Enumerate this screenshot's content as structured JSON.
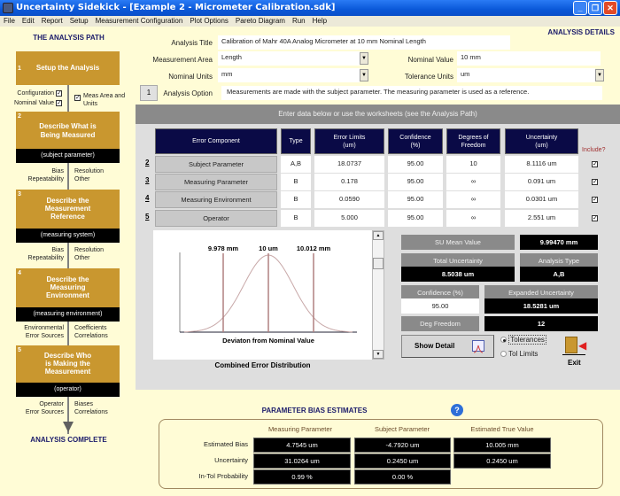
{
  "window": {
    "title": "Uncertainty Sidekick - [Example 2 - Micrometer Calibration.sdk]",
    "controls": {
      "minimize": "_",
      "maximize": "❐",
      "close": "✕"
    }
  },
  "menu": [
    "File",
    "Edit",
    "Report",
    "Setup",
    "Measurement Configuration",
    "Plot Options",
    "Pareto Diagram",
    "Run",
    "Help"
  ],
  "path": {
    "title": "THE ANALYSIS PATH",
    "steps": [
      {
        "num": "1",
        "title": "Setup the Analysis",
        "sub": ""
      },
      {
        "num": "2",
        "title": "Describe What is Being Measured",
        "sub": "(subject parameter)"
      },
      {
        "num": "3",
        "title": "Describe the Measurement Reference",
        "sub": "(measuring system)"
      },
      {
        "num": "4",
        "title": "Describe the Measuring Environment",
        "sub": "(measuring environment)"
      },
      {
        "num": "5",
        "title": "Describe Who is Making the Measurement",
        "sub": "(operator)"
      }
    ],
    "setup_checks": {
      "configuration": "Configuration",
      "nominal_value": "Nominal Value",
      "meas_area": "Meas Area and Units"
    },
    "step2_left": [
      "Bias",
      "Repeatability"
    ],
    "step2_right": [
      "Resolution",
      "Other"
    ],
    "step3_left": [
      "Bias",
      "Repeatability"
    ],
    "step3_right": [
      "Resolution",
      "Other"
    ],
    "step4_left": [
      "Environmental",
      "Error Sources"
    ],
    "step4_right": [
      "Coefficients",
      "Correlations"
    ],
    "step5_left": [
      "Operator",
      "Error Sources"
    ],
    "step5_right": [
      "Biases",
      "Correlations"
    ],
    "complete": "ANALYSIS COMPLETE"
  },
  "details": {
    "title": "ANALYSIS DETAILS",
    "analysis_title_label": "Analysis Title",
    "analysis_title": "Calibration of Mahr 40A Analog Micrometer at 10 mm Nominal Length",
    "measurement_area_label": "Measurement Area",
    "measurement_area": "Length",
    "nominal_value_label": "Nominal Value",
    "nominal_value": "10 mm",
    "nominal_units_label": "Nominal Units",
    "nominal_units": "mm",
    "tolerance_units_label": "Tolerance Units",
    "tolerance_units": "um",
    "option_button": "1",
    "analysis_option_label": "Analysis Option",
    "analysis_option": "Measurements are made with the subject parameter.  The measuring parameter is used as a reference."
  },
  "table": {
    "banner": "Enter data below or use the worksheets (see the Analysis Path)",
    "headers": [
      "Error Component",
      "Type",
      "Error Limits (um)",
      "Confidence (%)",
      "Degrees of Freedom",
      "Uncertainty (um)"
    ],
    "include_label": "Include?",
    "rows": [
      {
        "num": "2",
        "component": "Subject Parameter",
        "type": "A,B",
        "limits": "18.0737",
        "confidence": "95.00",
        "dof": "10",
        "uncertainty": "8.1116 um",
        "include": true
      },
      {
        "num": "3",
        "component": "Measuring Parameter",
        "type": "B",
        "limits": "0.178",
        "confidence": "95.00",
        "dof": "∞",
        "uncertainty": "0.091 um",
        "include": true
      },
      {
        "num": "4",
        "component": "Measuring Environment",
        "type": "B",
        "limits": "0.0590",
        "confidence": "95.00",
        "dof": "∞",
        "uncertainty": "0.0301 um",
        "include": true
      },
      {
        "num": "5",
        "component": "Operator",
        "type": "B",
        "limits": "5.000",
        "confidence": "95.00",
        "dof": "∞",
        "uncertainty": "2.551 um",
        "include": true
      }
    ]
  },
  "chart": {
    "caption": "Combined Error Distribution",
    "xlabel": "Deviaton from Nominal Value",
    "markers": [
      {
        "label": "9.978 mm",
        "position": -1
      },
      {
        "label": "10 um",
        "position": 0
      },
      {
        "label": "10.012 mm",
        "position": 1
      }
    ],
    "curve_color": "#c8a8a8",
    "marker_color": "#b08080"
  },
  "results": {
    "su_mean_label": "SU Mean Value",
    "su_mean": "9.99470 mm",
    "total_unc_label": "Total Uncertainty",
    "total_unc": "8.5038 um",
    "analysis_type_label": "Analysis Type",
    "analysis_type": "A,B",
    "confidence_label": "Confidence (%)",
    "confidence": "95.00",
    "expanded_label": "Expanded Uncertainty",
    "expanded": "18.5281 um",
    "dof_label": "Deg Freedom",
    "dof": "12",
    "show_detail": "Show Detail",
    "radio_tolerances": "Tolerances",
    "radio_tol_limits": "Tol Limits",
    "exit": "Exit"
  },
  "bias": {
    "title": "PARAMETER BIAS ESTIMATES",
    "help": "?",
    "columns": [
      "Measuring Parameter",
      "Subject Parameter",
      "Estimated True Value"
    ],
    "row_labels": [
      "Estimated Bias",
      "Uncertainty",
      "In-Tol Probability"
    ],
    "values": [
      [
        "4.7545 um",
        "-4.7920 um",
        "10.005 mm"
      ],
      [
        "31.0264 um",
        "0.2450 um",
        "0.2450 um"
      ],
      [
        "0.99 %",
        "0.00 %"
      ]
    ]
  }
}
